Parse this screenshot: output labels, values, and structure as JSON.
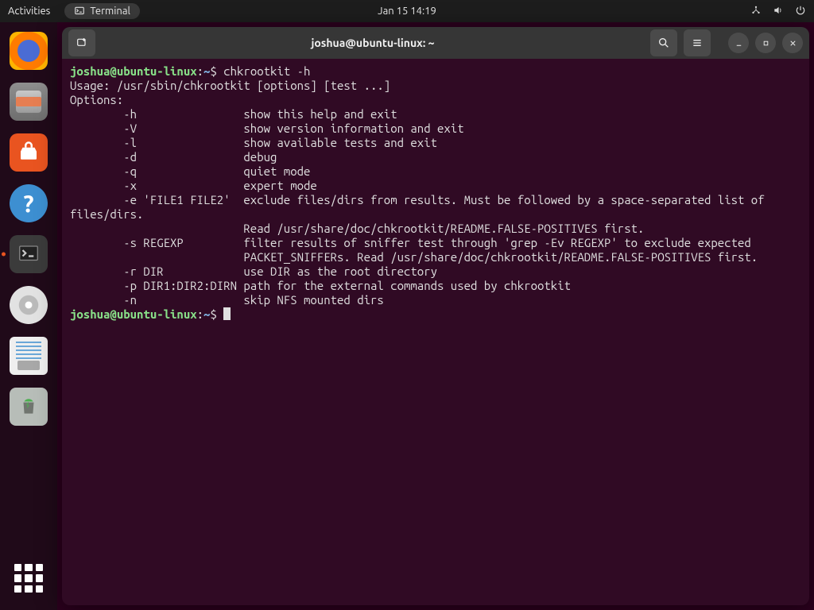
{
  "topbar": {
    "activities": "Activities",
    "app_indicator": "Terminal",
    "clock": "Jan 15  14:19"
  },
  "dock": {
    "items": [
      {
        "name": "firefox-icon"
      },
      {
        "name": "files-icon"
      },
      {
        "name": "software-icon"
      },
      {
        "name": "help-icon"
      },
      {
        "name": "terminal-icon",
        "active": true
      },
      {
        "name": "disc-icon"
      },
      {
        "name": "save-icon"
      },
      {
        "name": "trash-icon"
      }
    ]
  },
  "window": {
    "title": "joshua@ubuntu-linux: ~"
  },
  "terminal": {
    "prompt": {
      "user": "joshua",
      "at": "@",
      "host": "ubuntu-linux",
      "colon": ":",
      "path": "~",
      "dollar": "$"
    },
    "cmd1": "chkrootkit -h",
    "usage": "Usage: /usr/sbin/chkrootkit [options] [test ...]",
    "options_label": "Options:",
    "opts": [
      {
        "flag": "        -h                ",
        "desc": "show this help and exit"
      },
      {
        "flag": "        -V                ",
        "desc": "show version information and exit"
      },
      {
        "flag": "        -l                ",
        "desc": "show available tests and exit"
      },
      {
        "flag": "        -d                ",
        "desc": "debug"
      },
      {
        "flag": "        -q                ",
        "desc": "quiet mode"
      },
      {
        "flag": "        -x                ",
        "desc": "expert mode"
      },
      {
        "flag": "        -e 'FILE1 FILE2'  ",
        "desc": "exclude files/dirs from results. Must be followed by a space-separated list of"
      }
    ],
    "wrap1": "files/dirs.",
    "wrap2": "                          Read /usr/share/doc/chkrootkit/README.FALSE-POSITIVES first.",
    "opts2": [
      {
        "flag": "        -s REGEXP         ",
        "desc": "filter results of sniffer test through 'grep -Ev REGEXP' to exclude expected"
      }
    ],
    "wrap3": "                          PACKET_SNIFFERs. Read /usr/share/doc/chkrootkit/README.FALSE-POSITIVES first.",
    "opts3": [
      {
        "flag": "        -r DIR            ",
        "desc": "use DIR as the root directory"
      },
      {
        "flag": "        -p DIR1:DIR2:DIRN ",
        "desc": "path for the external commands used by chkrootkit"
      },
      {
        "flag": "        -n                ",
        "desc": "skip NFS mounted dirs"
      }
    ]
  }
}
